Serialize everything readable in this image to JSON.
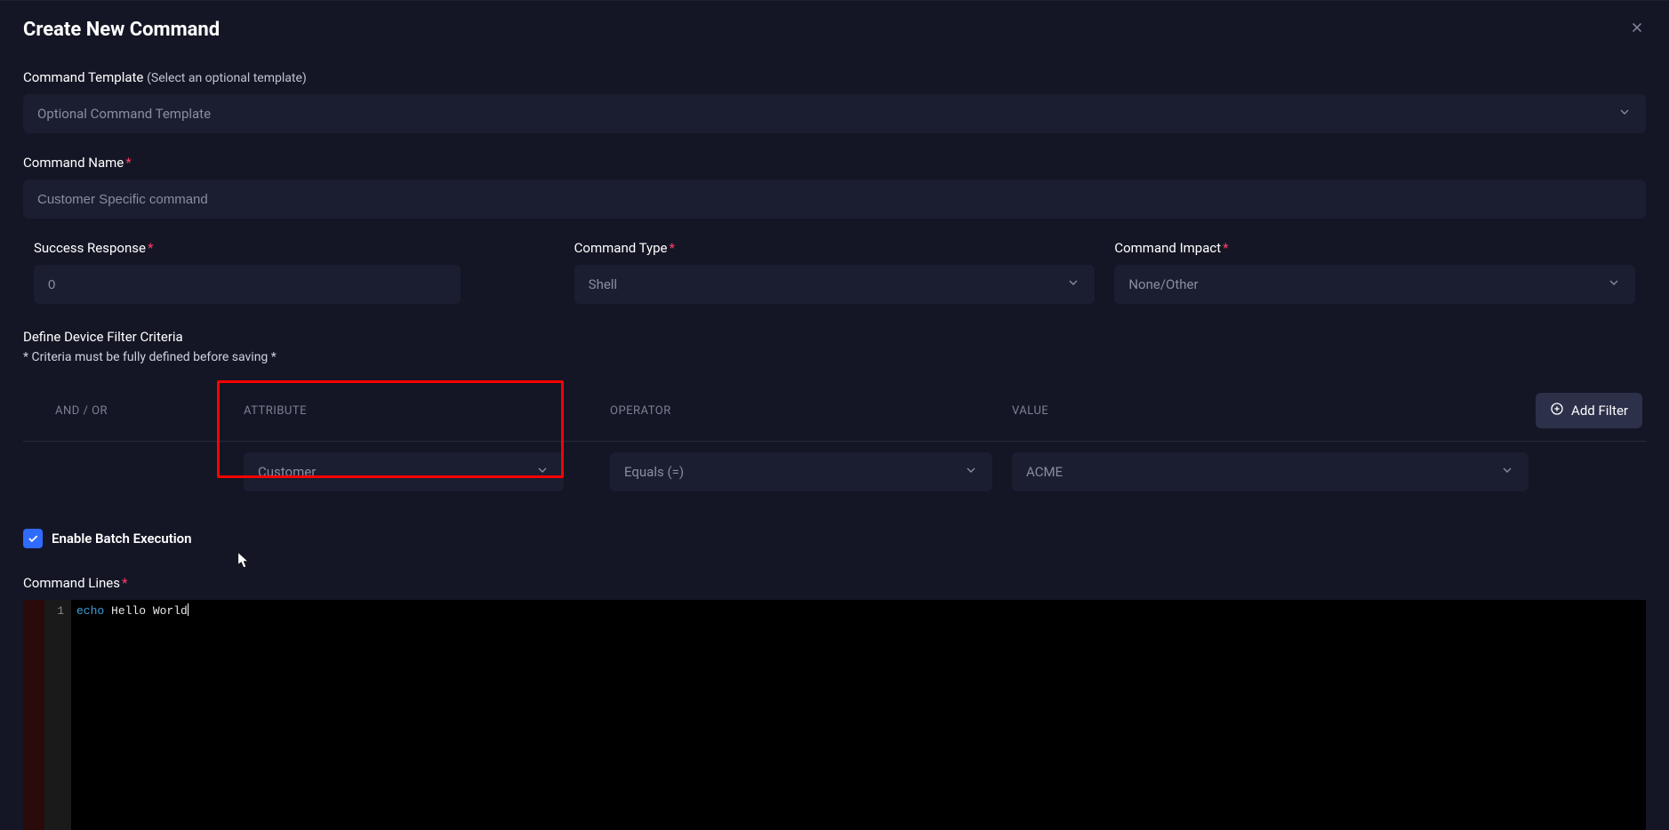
{
  "modal": {
    "title": "Create New Command",
    "close_icon": "close"
  },
  "template_field": {
    "label": "Command Template",
    "hint": "(Select an optional template)",
    "placeholder": "Optional Command Template"
  },
  "name_field": {
    "label": "Command Name",
    "value": "Customer Specific command"
  },
  "success_field": {
    "label": "Success Response",
    "value": "0"
  },
  "type_field": {
    "label": "Command Type",
    "value": "Shell"
  },
  "impact_field": {
    "label": "Command Impact",
    "value": "None/Other"
  },
  "filter_section": {
    "title": "Define Device Filter Criteria",
    "note": "* Criteria must be fully defined before saving *",
    "headers": {
      "andor": "AND / OR",
      "attribute": "ATTRIBUTE",
      "operator": "OPERATOR",
      "value": "VALUE"
    },
    "add_button": "Add Filter",
    "row": {
      "attribute": "Customer",
      "operator": "Equals (=)",
      "value": "ACME"
    }
  },
  "batch_checkbox": {
    "label": "Enable Batch Execution",
    "checked": true
  },
  "lines_section": {
    "label": "Command Lines",
    "line_number": "1",
    "code_keyword": "echo",
    "code_rest": " Hello World"
  }
}
